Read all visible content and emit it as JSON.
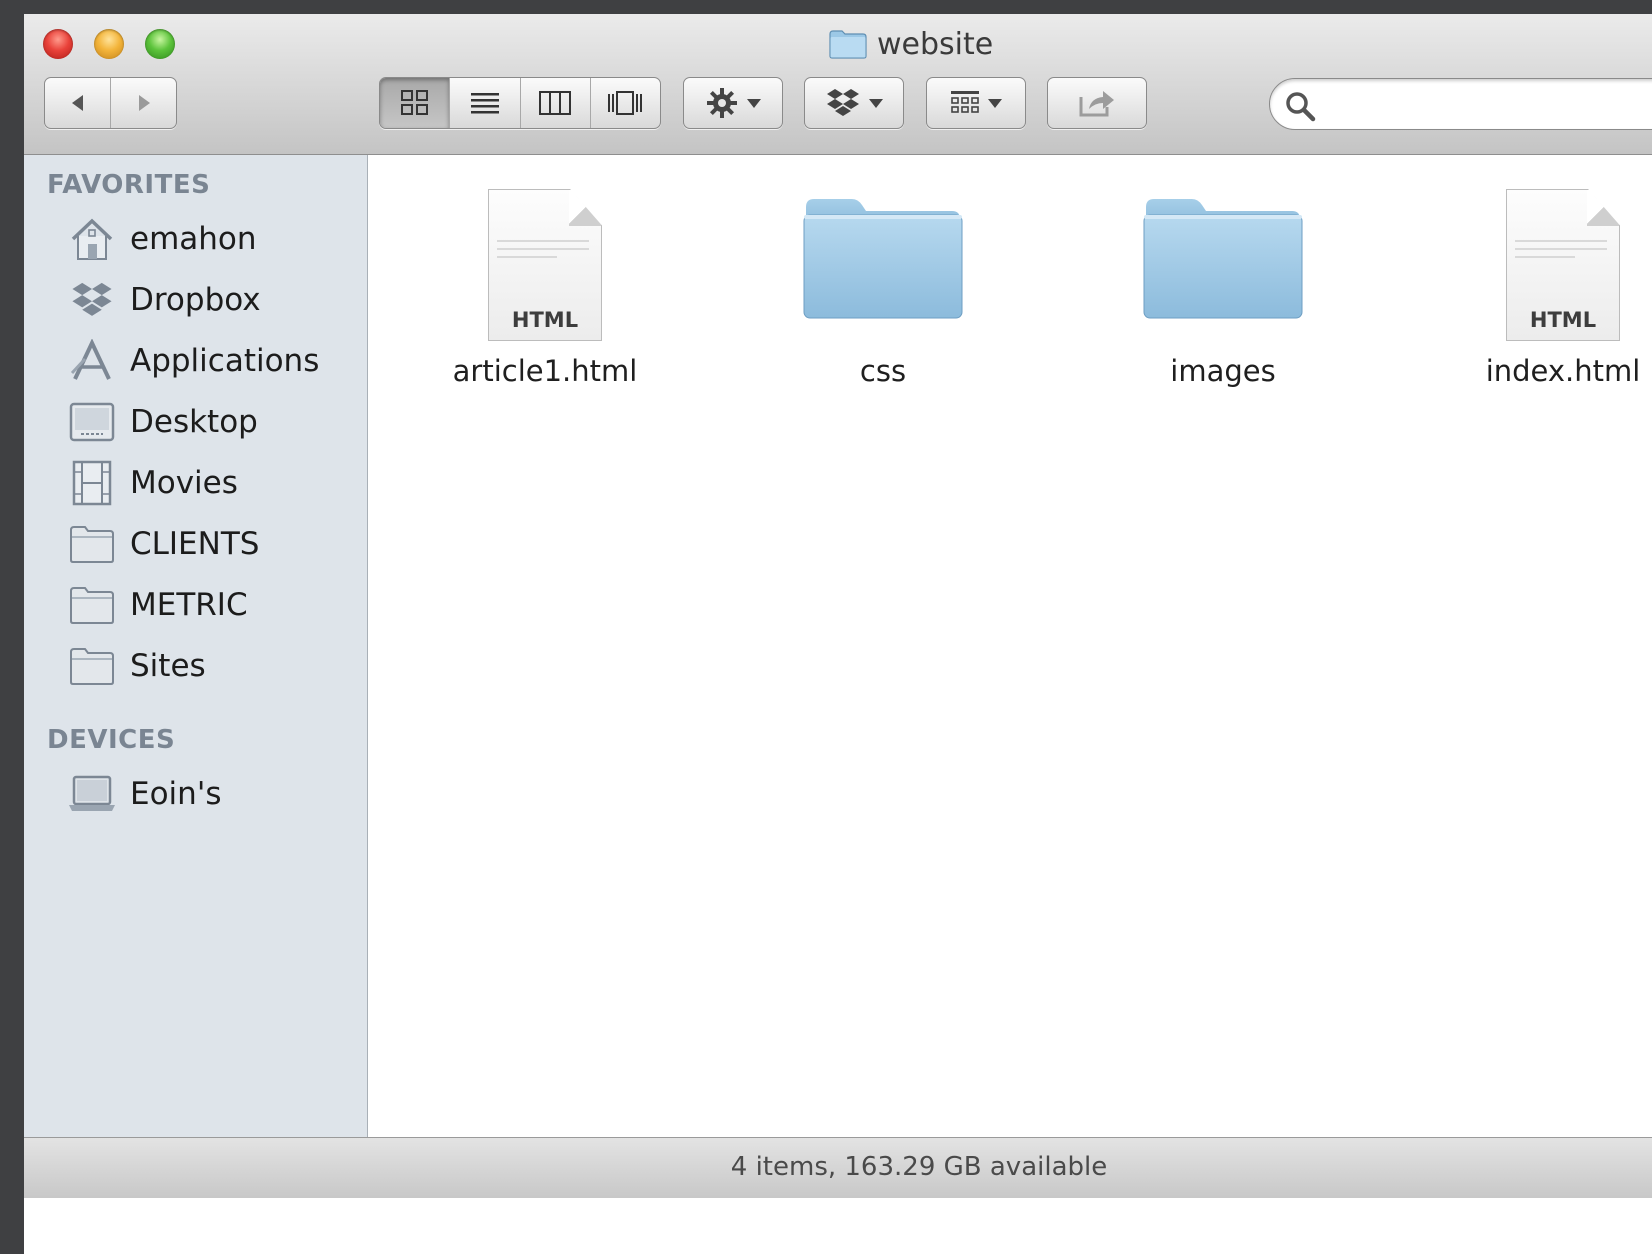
{
  "window": {
    "title": "website"
  },
  "toolbar": {
    "back_icon": "back-arrow-icon",
    "forward_icon": "forward-arrow-icon",
    "view_modes": [
      "icon-view-icon",
      "list-view-icon",
      "column-view-icon",
      "cover-flow-icon"
    ],
    "active_view": "icon-view-icon",
    "action_icon": "gear-icon",
    "dropbox_icon": "dropbox-icon",
    "arrange_icon": "arrange-icon",
    "share_icon": "share-icon"
  },
  "search": {
    "value": "",
    "placeholder": ""
  },
  "sidebar": {
    "favorites_header": "FAVORITES",
    "favorites": [
      {
        "label": "emahon",
        "icon": "home-icon"
      },
      {
        "label": "Dropbox",
        "icon": "dropbox-icon"
      },
      {
        "label": "Applications",
        "icon": "applications-icon"
      },
      {
        "label": "Desktop",
        "icon": "desktop-icon"
      },
      {
        "label": "Movies",
        "icon": "movies-icon"
      },
      {
        "label": "CLIENTS",
        "icon": "folder-icon"
      },
      {
        "label": "METRIC",
        "icon": "folder-icon"
      },
      {
        "label": "Sites",
        "icon": "folder-icon"
      }
    ],
    "devices_header": "DEVICES",
    "devices": [
      {
        "label": "Eoin's",
        "icon": "laptop-icon"
      }
    ]
  },
  "files": [
    {
      "name": "article1.html",
      "kind": "html",
      "badge": "HTML"
    },
    {
      "name": "css",
      "kind": "folder"
    },
    {
      "name": "images",
      "kind": "folder"
    },
    {
      "name": "index.html",
      "kind": "html",
      "badge": "HTML"
    }
  ],
  "status": {
    "text": "4 items, 163.29 GB available"
  },
  "colors": {
    "folder_blue": "#8fbfdf",
    "sidebar_bg": "#dee4ea",
    "sidebar_header": "#7a8592"
  }
}
